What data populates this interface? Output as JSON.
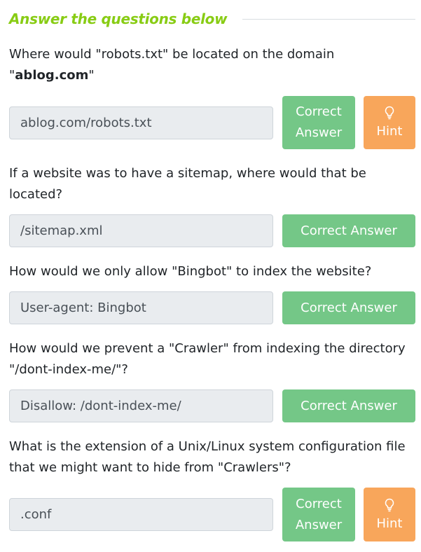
{
  "header": {
    "title": "Answer the questions below"
  },
  "questions": [
    {
      "text_before": "Where would \"robots.txt\" be located on the domain \"",
      "text_bold": "ablog.com",
      "text_after": "\"",
      "answer": "ablog.com/robots.txt",
      "correct_line1": "Correct",
      "correct_line2": "Answer",
      "hint_label": "Hint"
    },
    {
      "text": "If a website was to have a sitemap, where would that be located?",
      "answer": "/sitemap.xml",
      "correct_label": "Correct Answer"
    },
    {
      "text": "How would we only allow \"Bingbot\" to index the website?",
      "answer": "User-agent: Bingbot",
      "correct_label": "Correct Answer"
    },
    {
      "text": "How would we prevent a \"Crawler\" from indexing the directory \"/dont-index-me/\"?",
      "answer": "Disallow: /dont-index-me/",
      "correct_label": "Correct Answer"
    },
    {
      "text": "What is the extension of a Unix/Linux system configuration file that we might want to hide from \"Crawlers\"?",
      "answer": ".conf",
      "correct_line1": "Correct",
      "correct_line2": "Answer",
      "hint_label": "Hint"
    }
  ],
  "icons": {
    "hint": "lightbulb-icon"
  },
  "colors": {
    "header": "#88cc14",
    "correct": "#74c787",
    "hint": "#f8a65b",
    "input_bg": "#e9ecef"
  }
}
